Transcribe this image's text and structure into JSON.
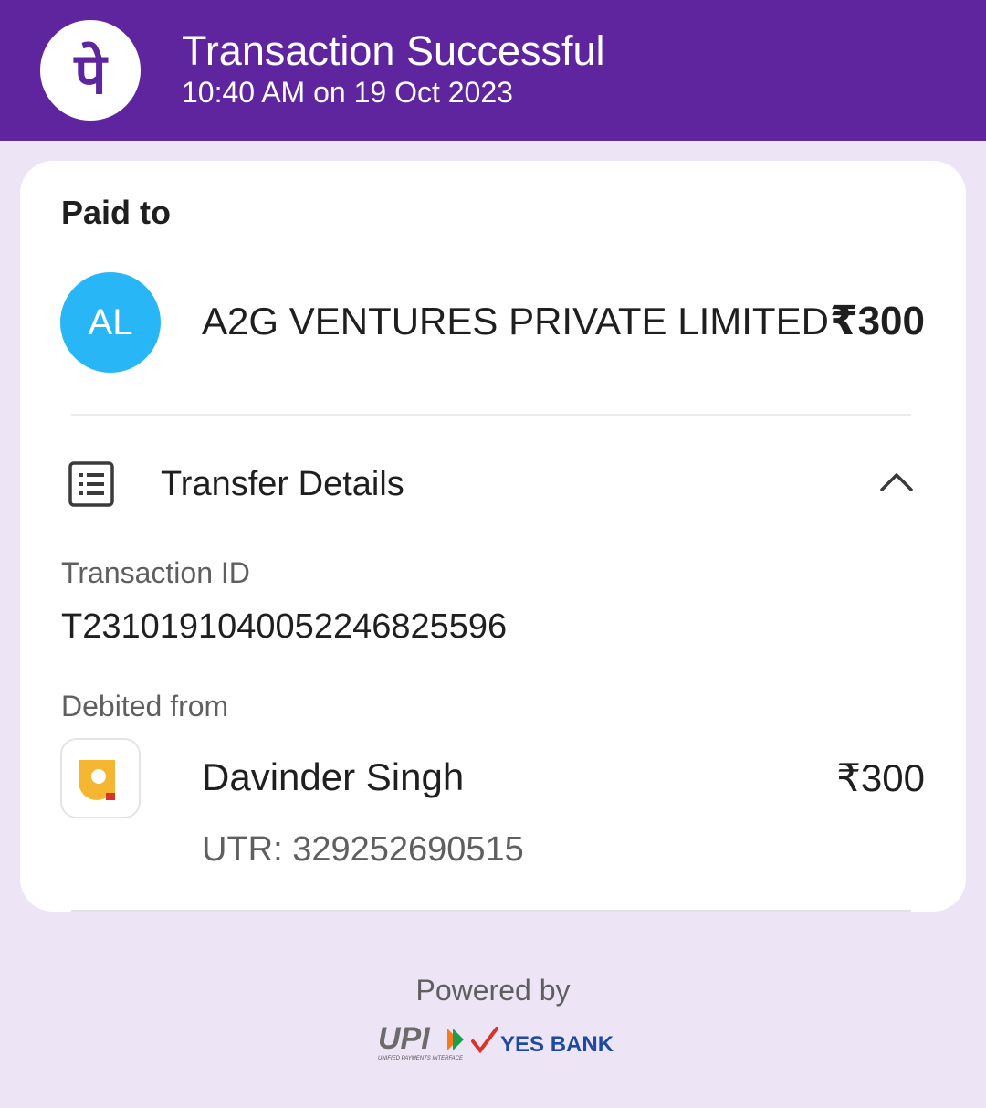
{
  "header": {
    "title": "Transaction Successful",
    "timestamp": "10:40 AM on 19 Oct 2023",
    "logo_icon": "phonepe-logo-icon",
    "logo_glyph": "पे",
    "background": "#5f259f"
  },
  "paid_to": {
    "label": "Paid to",
    "avatar_initials": "AL",
    "avatar_color": "#29b6f6",
    "name": "A2G VENTURES PRIVATE LIMITED",
    "amount": "₹300"
  },
  "transfer_details": {
    "title": "Transfer Details",
    "icon": "receipt-list-icon",
    "toggle_icon": "chevron-up-icon",
    "transaction_id_label": "Transaction ID",
    "transaction_id": "T2310191040052246825596",
    "debited_from_label": "Debited from",
    "account": {
      "bank_icon": "pnb-bank-logo-icon",
      "name": "Davinder Singh",
      "amount": "₹300",
      "utr": "UTR: 329252690515"
    }
  },
  "footer": {
    "powered_by": "Powered by",
    "upi_logo": "UPI",
    "upi_tagline": "UNIFIED PAYMENTS INTERFACE",
    "bank_logo": "YES BANK"
  }
}
